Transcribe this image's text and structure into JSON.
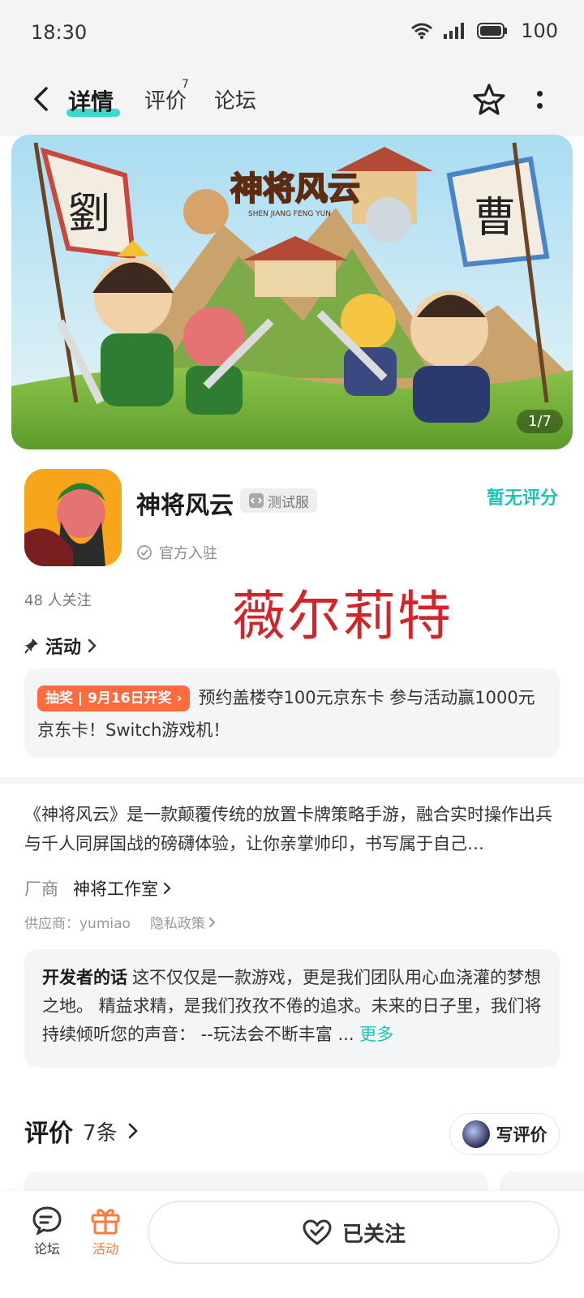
{
  "status_bar": {
    "time": "18:30",
    "battery": "100"
  },
  "header": {
    "tabs": [
      {
        "label": "详情",
        "active": true
      },
      {
        "label": "评价",
        "badge": "7"
      },
      {
        "label": "论坛"
      }
    ]
  },
  "banner": {
    "counter": "1/7",
    "logo_text": "神将风云",
    "logo_sub": "SHEN JIANG FENG YUN",
    "flag_left": "劉",
    "flag_right": "曹"
  },
  "app": {
    "name": "神将风云",
    "test_badge": "测试服",
    "rating_text": "暂无评分",
    "official_text": "官方入驻",
    "followers": "48 人关注",
    "watermark": "薇尔莉特"
  },
  "activity": {
    "title": "活动",
    "tag": "抽奖 | 9月16日开奖",
    "text": "预约盖楼夺100元京东卡 参与活动赢1000元京东卡！Switch游戏机！"
  },
  "description": "《神将风云》是一款颠覆传统的放置卡牌策略手游，融合实时操作出兵与千人同屏国战的磅礴体验，让你亲掌帅印，书写属于自己…",
  "vendor": {
    "label": "厂商",
    "name": "神将工作室"
  },
  "supplier": {
    "text": "供应商：yumiao",
    "privacy": "隐私政策"
  },
  "developer": {
    "label": "开发者的话",
    "text": "这不仅仅是一款游戏，更是我们团队用心血浇灌的梦想之地。 精益求精，是我们孜孜不倦的追求。未来的日子里，我们将持续倾听您的声音： --玩法会不断丰富 ...",
    "more": "更多"
  },
  "reviews": {
    "title": "评价",
    "count": "7条",
    "write_label": "写评价"
  },
  "bottom_bar": {
    "forum_label": "论坛",
    "activity_label": "活动",
    "follow_label": "已关注"
  },
  "colors": {
    "accent": "#19d3c5",
    "orange": "#ff6b3d",
    "watermark_red": "#d4242a"
  }
}
